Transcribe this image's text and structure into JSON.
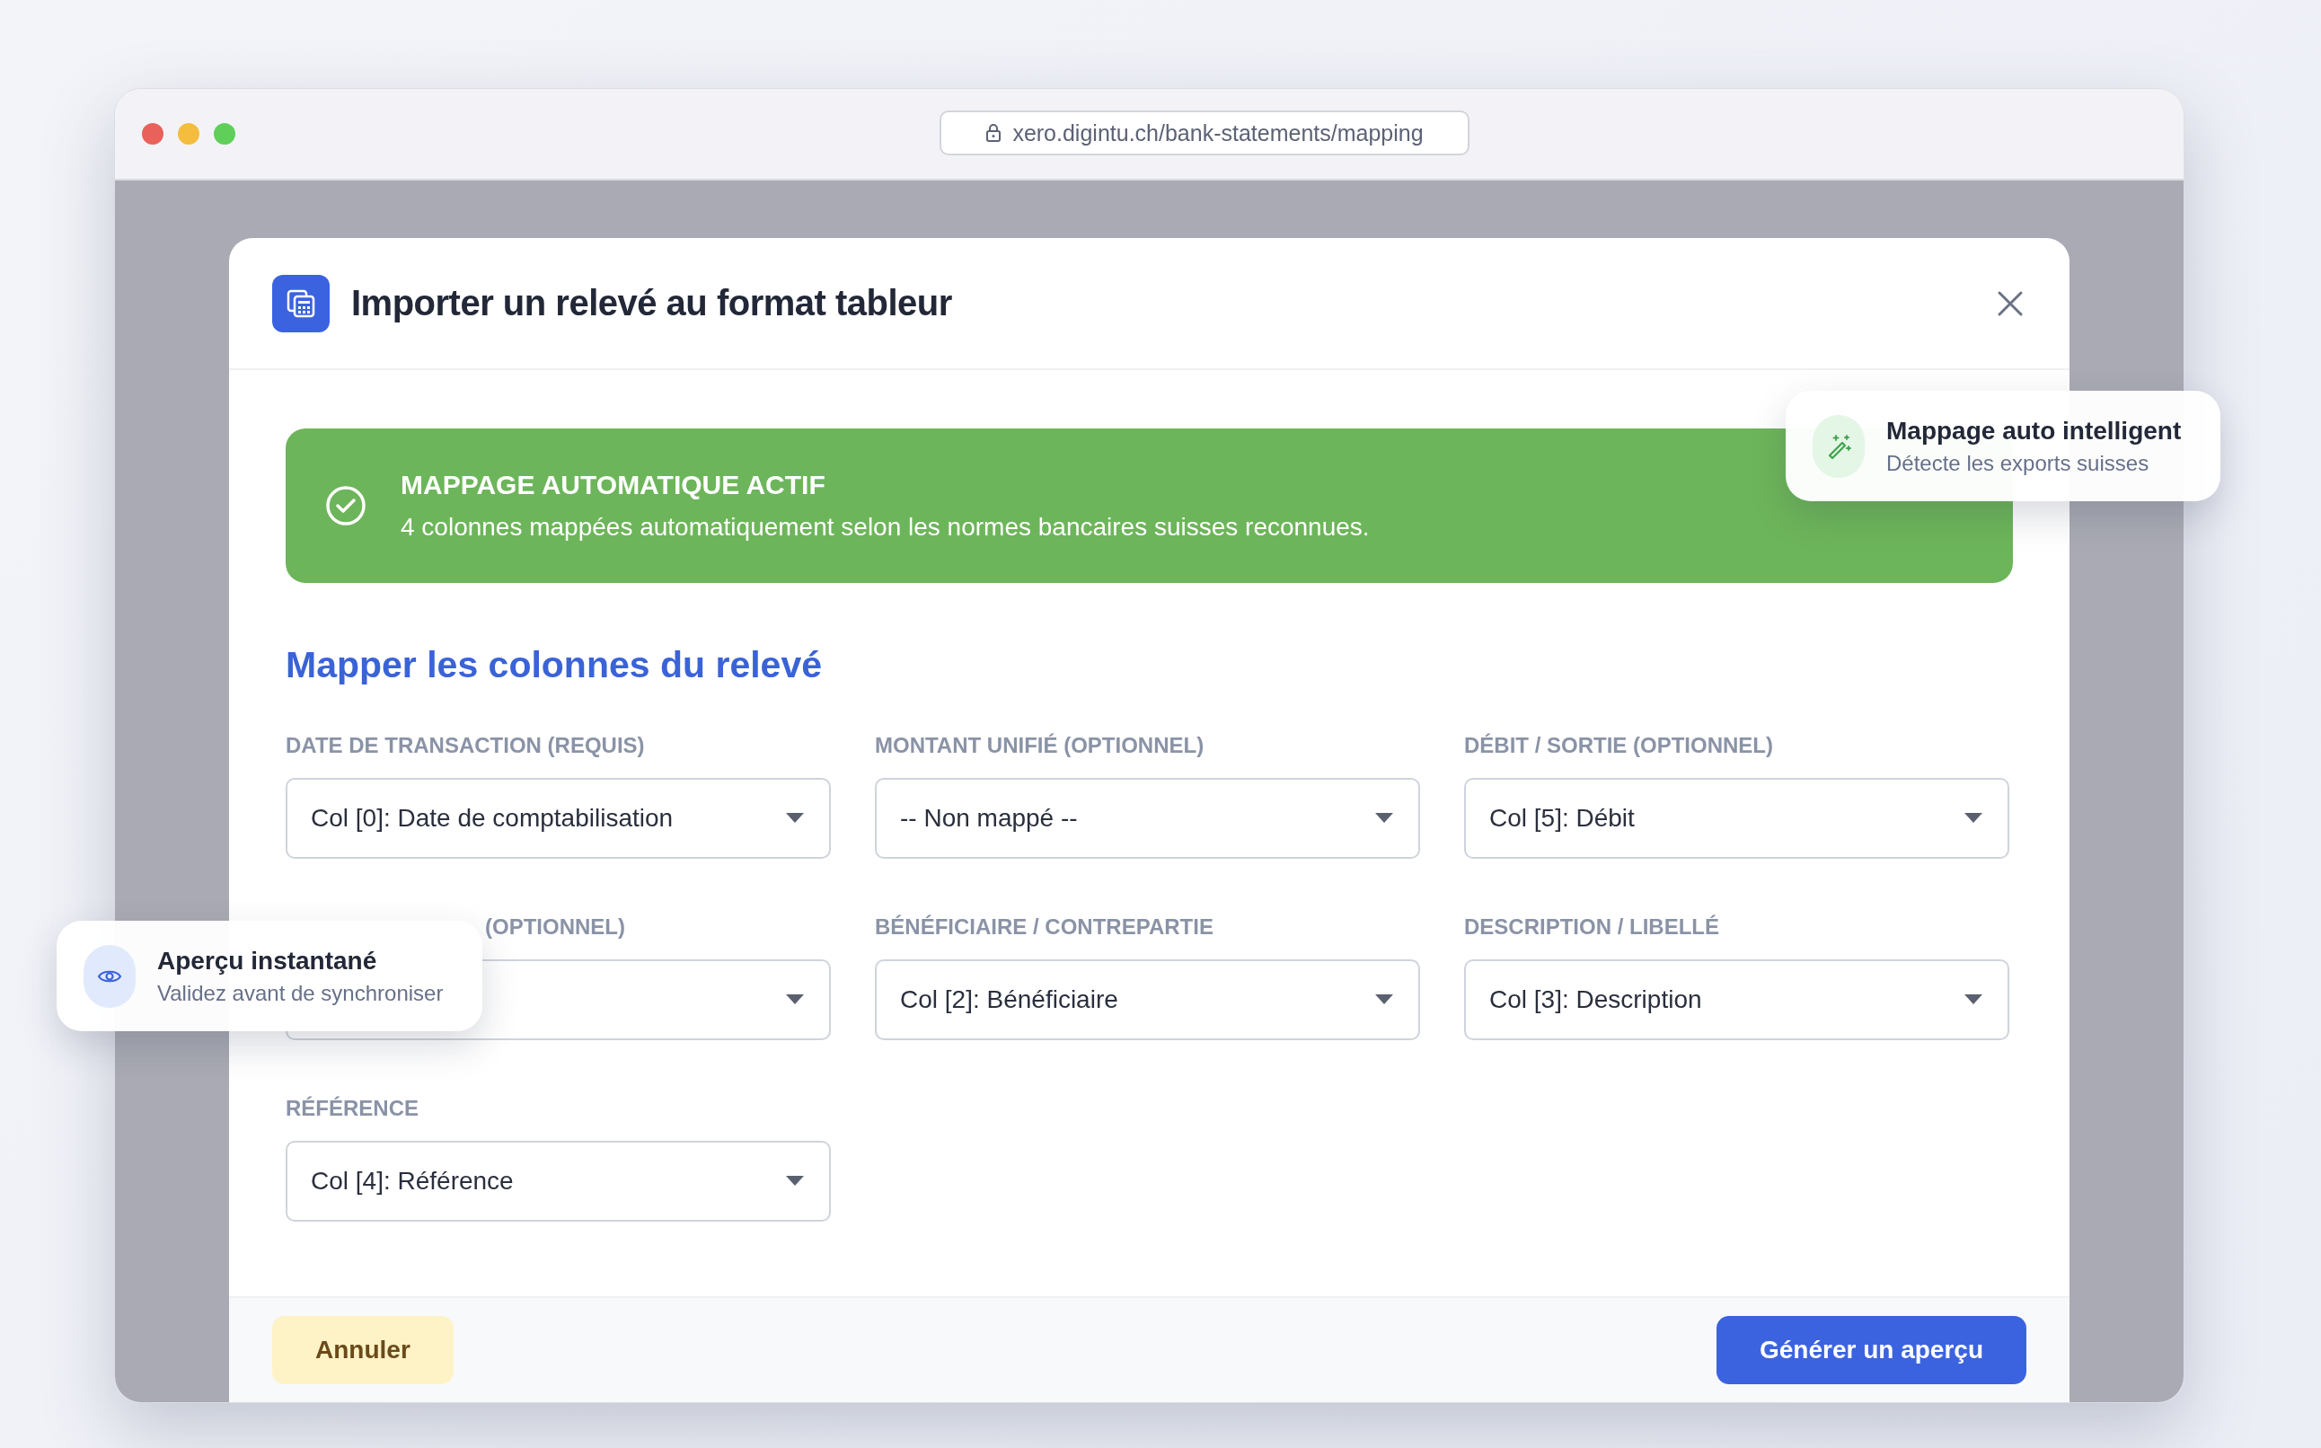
{
  "browser": {
    "url": "xero.digintu.ch/bank-statements/mapping"
  },
  "modal": {
    "title": "Importer un relevé au format tableur",
    "banner": {
      "title": "MAPPAGE AUTOMATIQUE ACTIF",
      "message": "4 colonnes mappées automatiquement selon les normes bancaires suisses reconnues."
    },
    "section_title": "Mapper les colonnes du relevé",
    "fields": [
      {
        "label": "DATE DE TRANSACTION (REQUIS)",
        "value": "Col [0]: Date de comptabilisation"
      },
      {
        "label": "MONTANT UNIFIÉ (OPTIONNEL)",
        "value": "-- Non mappé --"
      },
      {
        "label": "DÉBIT / SORTIE (OPTIONNEL)",
        "value": "Col [5]: Débit"
      },
      {
        "label": "(OPTIONNEL)",
        "kind": "covered"
      },
      {
        "label": "BÉNÉFICIAIRE / CONTREPARTIE",
        "value": "Col [2]: Bénéficiaire"
      },
      {
        "label": "DESCRIPTION / LIBELLÉ",
        "value": "Col [3]: Description"
      },
      {
        "label": "RÉFÉRENCE",
        "value": "Col [4]: Référence"
      }
    ],
    "buttons": [
      {
        "label": "Annuler",
        "kind": "secondary"
      },
      {
        "label": "Générer un aperçu",
        "kind": "primary"
      }
    ]
  },
  "floating_cards": [
    {
      "kind": "magic",
      "title": "Mappage auto intelligent",
      "subtitle": "Détecte les exports suisses"
    },
    {
      "kind": "eye",
      "title": "Aperçu instantané",
      "subtitle": "Validez avant de synchroniser"
    }
  ]
}
